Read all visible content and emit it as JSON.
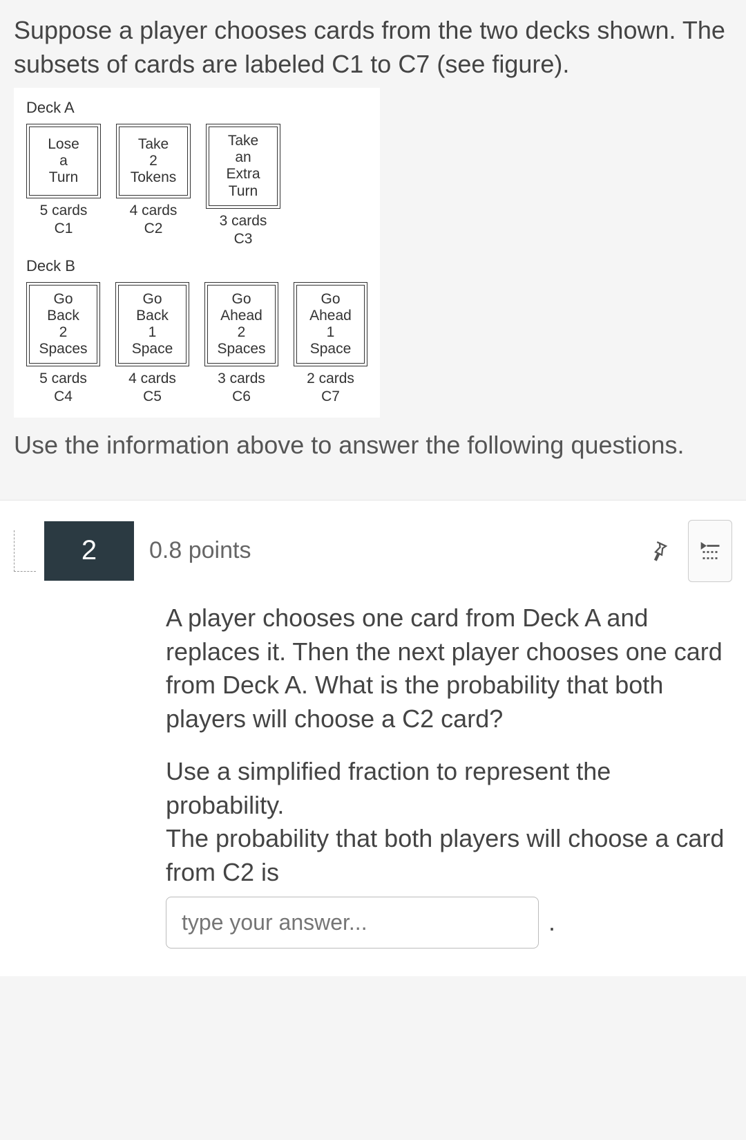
{
  "intro": "Suppose a player chooses cards from the two decks shown. The subsets of cards are labeled C1 to C7 (see figure).",
  "deckA": {
    "label": "Deck A",
    "cards": [
      {
        "lines": [
          "Lose",
          "a",
          "Turn"
        ],
        "count": "5 cards",
        "id": "C1"
      },
      {
        "lines": [
          "Take",
          "2",
          "Tokens"
        ],
        "count": "4 cards",
        "id": "C2"
      },
      {
        "lines": [
          "Take",
          "an",
          "Extra",
          "Turn"
        ],
        "count": "3 cards",
        "id": "C3"
      }
    ]
  },
  "deckB": {
    "label": "Deck B",
    "cards": [
      {
        "lines": [
          "Go",
          "Back",
          "2",
          "Spaces"
        ],
        "count": "5 cards",
        "id": "C4"
      },
      {
        "lines": [
          "Go",
          "Back",
          "1",
          "Space"
        ],
        "count": "4 cards",
        "id": "C5"
      },
      {
        "lines": [
          "Go",
          "Ahead",
          "2",
          "Spaces"
        ],
        "count": "3 cards",
        "id": "C6"
      },
      {
        "lines": [
          "Go",
          "Ahead",
          "1",
          "Space"
        ],
        "count": "2 cards",
        "id": "C7"
      }
    ]
  },
  "post_figure": "Use the information above to answer the following questions.",
  "question": {
    "number": "2",
    "points": "0.8 points",
    "para1": "A player chooses one card from Deck A and replaces it. Then the next player chooses one card from Deck A. What is the probability that both players will choose a C2 card?",
    "para2": "Use a simplified fraction to represent the probability.",
    "para3": "The probability that both players will choose a card from C2 is",
    "placeholder": "type your answer...",
    "period": "."
  }
}
